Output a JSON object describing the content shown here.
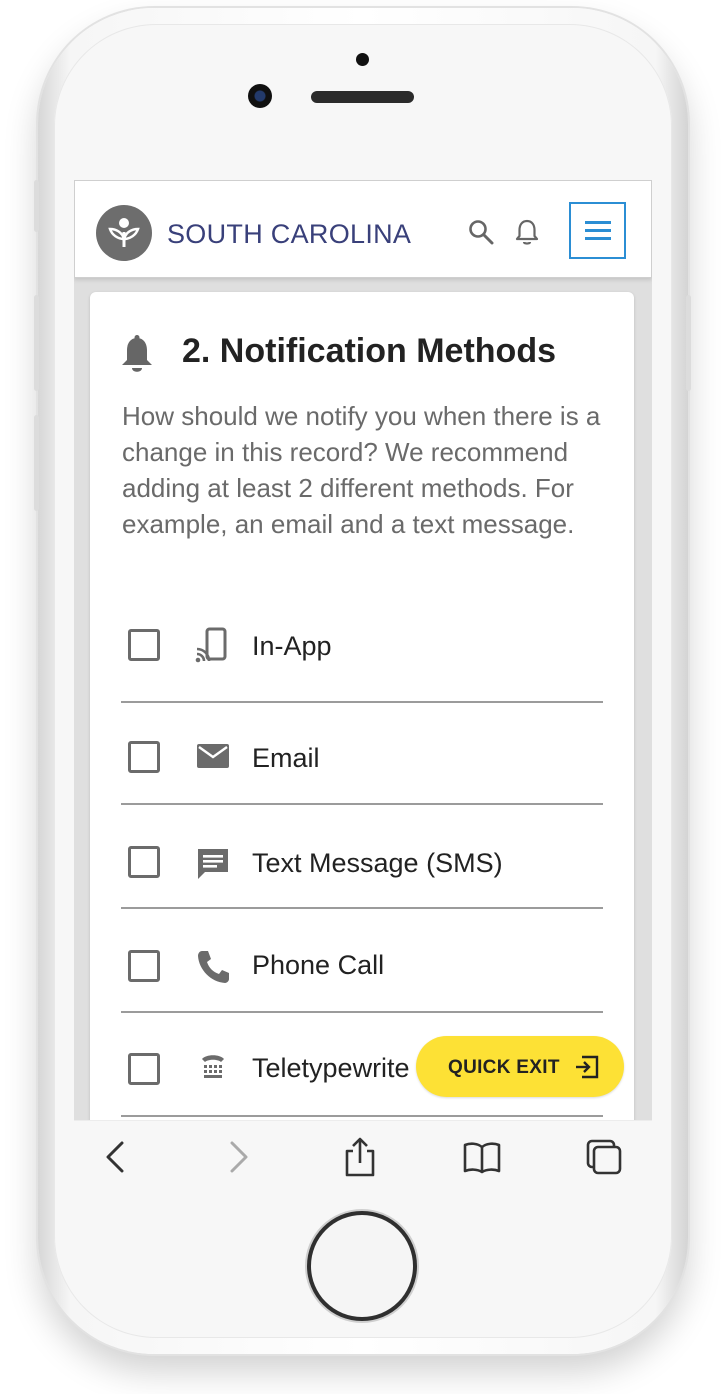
{
  "header": {
    "brand": "SOUTH CAROLINA"
  },
  "card": {
    "title": "2. Notification Methods",
    "description": "How should we notify you when there is a change in this record? We recommend adding at least 2 different methods. For example, an email and a text message."
  },
  "options": [
    {
      "label": "In-App",
      "icon": "phone-cast-icon",
      "checked": false
    },
    {
      "label": "Email",
      "icon": "mail-icon",
      "checked": false
    },
    {
      "label": "Text Message (SMS)",
      "icon": "sms-icon",
      "checked": false
    },
    {
      "label": "Phone Call",
      "icon": "phone-icon",
      "checked": false
    },
    {
      "label": "Teletypewrite",
      "icon": "teletype-icon",
      "checked": false
    }
  ],
  "quick_exit": {
    "label": "QUICK EXIT"
  },
  "colors": {
    "accent": "#2b8ed4",
    "brand": "#39407a",
    "quick_exit": "#fde135",
    "icon": "#6b6b6b"
  },
  "browser_toolbar": {
    "icons": [
      "back-icon",
      "forward-icon",
      "share-icon",
      "bookmarks-icon",
      "tabs-icon"
    ]
  }
}
